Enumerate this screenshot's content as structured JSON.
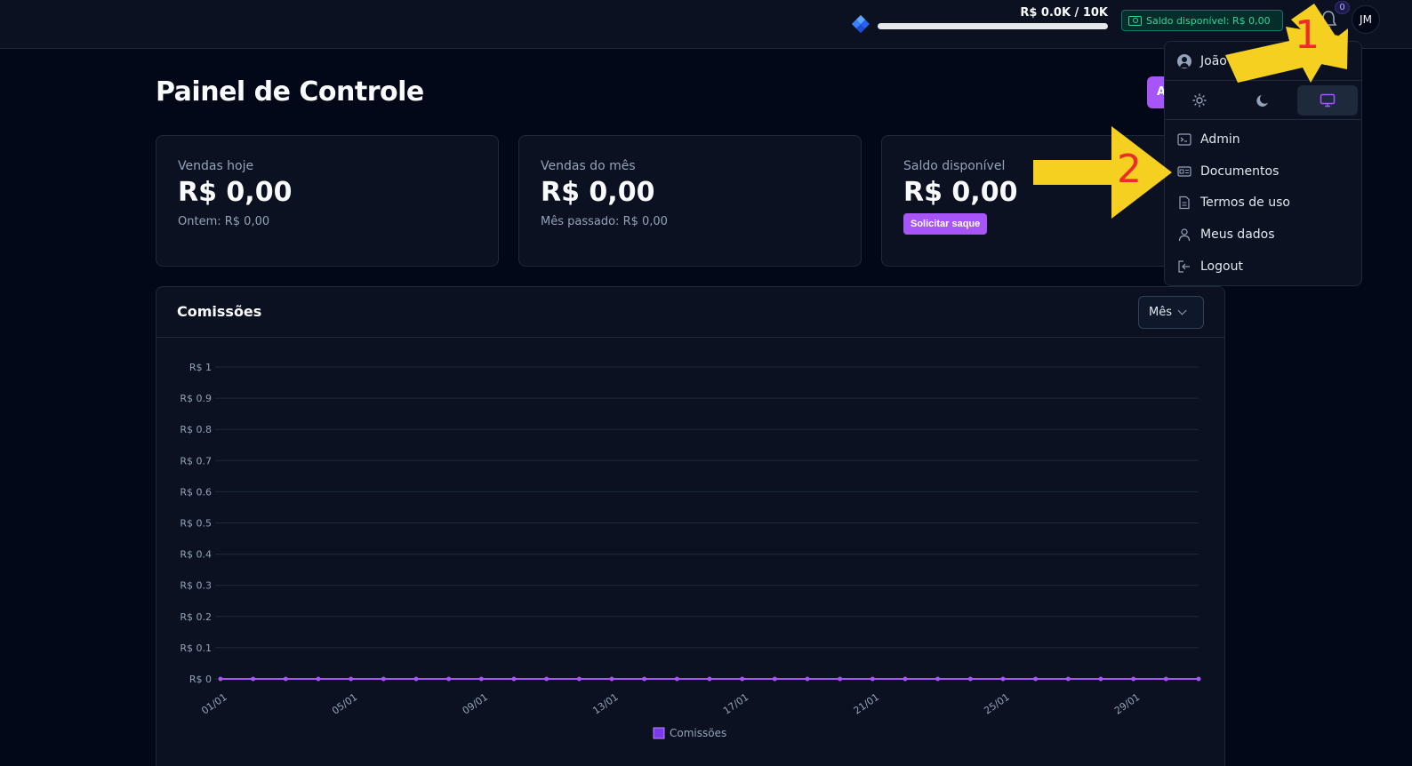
{
  "topbar": {
    "goal_text": "R$ 0.0K / 10K",
    "goal_progress": 0,
    "saldo_chip": "Saldo disponível: R$ 0,00",
    "notification_count": "0",
    "avatar_initials": "JM"
  },
  "page": {
    "title": "Painel de Controle",
    "action_button_label": "A"
  },
  "cards": [
    {
      "label": "Vendas hoje",
      "value": "R$ 0,00",
      "sub": "Ontem: R$ 0,00"
    },
    {
      "label": "Vendas do mês",
      "value": "R$ 0,00",
      "sub": "Mês passado: R$ 0,00"
    },
    {
      "label": "Saldo disponível",
      "value": "R$ 0,00",
      "button": "Solicitar saque"
    }
  ],
  "chart_section": {
    "title": "Comissões",
    "period": "Mês"
  },
  "chart_data": {
    "type": "line",
    "title": "",
    "xlabel": "",
    "ylabel": "",
    "ylim": [
      0,
      1
    ],
    "y_ticks": [
      "R$ 0",
      "R$ 0.1",
      "R$ 0.2",
      "R$ 0.3",
      "R$ 0.4",
      "R$ 0.5",
      "R$ 0.6",
      "R$ 0.7",
      "R$ 0.8",
      "R$ 0.9",
      "R$ 1"
    ],
    "x_tick_labels": [
      "01/01",
      "05/01",
      "09/01",
      "13/01",
      "17/01",
      "21/01",
      "25/01",
      "29/01"
    ],
    "categories": [
      "01/01",
      "02/01",
      "03/01",
      "04/01",
      "05/01",
      "06/01",
      "07/01",
      "08/01",
      "09/01",
      "10/01",
      "11/01",
      "12/01",
      "13/01",
      "14/01",
      "15/01",
      "16/01",
      "17/01",
      "18/01",
      "19/01",
      "20/01",
      "21/01",
      "22/01",
      "23/01",
      "24/01",
      "25/01",
      "26/01",
      "27/01",
      "28/01",
      "29/01",
      "30/01",
      "31/01"
    ],
    "series": [
      {
        "name": "Comissões",
        "color": "#a855f7",
        "values": [
          0,
          0,
          0,
          0,
          0,
          0,
          0,
          0,
          0,
          0,
          0,
          0,
          0,
          0,
          0,
          0,
          0,
          0,
          0,
          0,
          0,
          0,
          0,
          0,
          0,
          0,
          0,
          0,
          0,
          0,
          0
        ]
      }
    ],
    "grid": true,
    "legend": "bottom"
  },
  "menu": {
    "user_name": "João ... Mendonça ...",
    "items": [
      {
        "label": "Admin",
        "icon": "terminal-icon"
      },
      {
        "label": "Documentos",
        "icon": "id-card-icon"
      },
      {
        "label": "Termos de uso",
        "icon": "file-icon"
      },
      {
        "label": "Meus dados",
        "icon": "user-icon"
      },
      {
        "label": "Logout",
        "icon": "logout-icon"
      }
    ]
  },
  "annotations": [
    "1",
    "2"
  ],
  "colors": {
    "accent": "#a855f7",
    "background": "#020817",
    "card": "#0b1120",
    "success": "#34d399",
    "arrow": "#f5d020",
    "annotation_number": "#ef2a2a"
  }
}
